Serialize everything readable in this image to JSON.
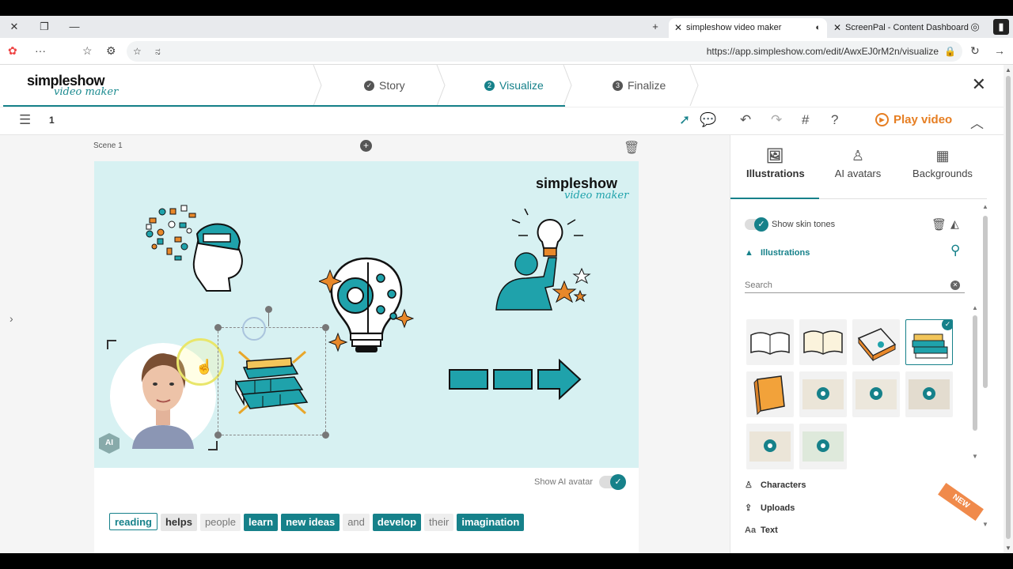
{
  "browser": {
    "tabs": [
      {
        "title": "simpleshow video maker",
        "active": true
      },
      {
        "title": "ScreenPal - Content Dashboard",
        "active": false
      }
    ],
    "address": "https://app.simpleshow.com/edit/AwxEJ0rM2n/visualize",
    "search_hint": "ನ"
  },
  "app": {
    "logo_line1": "simpleshow",
    "logo_line2": "video maker",
    "steps": [
      {
        "num": "✓",
        "label": "Story"
      },
      {
        "num": "2",
        "label": "Visualize"
      },
      {
        "num": "3",
        "label": "Finalize"
      }
    ]
  },
  "toolbar": {
    "scene_count": "1",
    "play_label": "Play video"
  },
  "editor": {
    "scene_label": "Scene 1",
    "canvas_logo_line1": "simpleshow",
    "canvas_logo_line2": "video maker",
    "ai_badge": "AI",
    "show_ai_label": "Show AI avatar",
    "words": [
      {
        "text": "reading",
        "style": "outline"
      },
      {
        "text": "helps",
        "style": "grey"
      },
      {
        "text": "people",
        "style": "plain"
      },
      {
        "text": "learn",
        "style": "teal"
      },
      {
        "text": "new ideas",
        "style": "teal"
      },
      {
        "text": "and",
        "style": "plain"
      },
      {
        "text": "develop",
        "style": "teal"
      },
      {
        "text": "their",
        "style": "plain"
      },
      {
        "text": "imagination",
        "style": "teal"
      }
    ]
  },
  "panel": {
    "tabs": [
      {
        "label": "Illustrations",
        "icon": "image-icon"
      },
      {
        "label": "AI avatars",
        "icon": "avatar-icon"
      },
      {
        "label": "Backgrounds",
        "icon": "grid-icon"
      }
    ],
    "show_skin_tones": "Show skin tones",
    "illustrations_title": "Illustrations",
    "search_placeholder": "Search",
    "characters": "Characters",
    "uploads": "Uploads",
    "text": "Text",
    "new_ribbon": "NEW"
  },
  "colors": {
    "accent": "#16818a",
    "play": "#e67e22",
    "canvas_bg": "#d7f1f2"
  }
}
